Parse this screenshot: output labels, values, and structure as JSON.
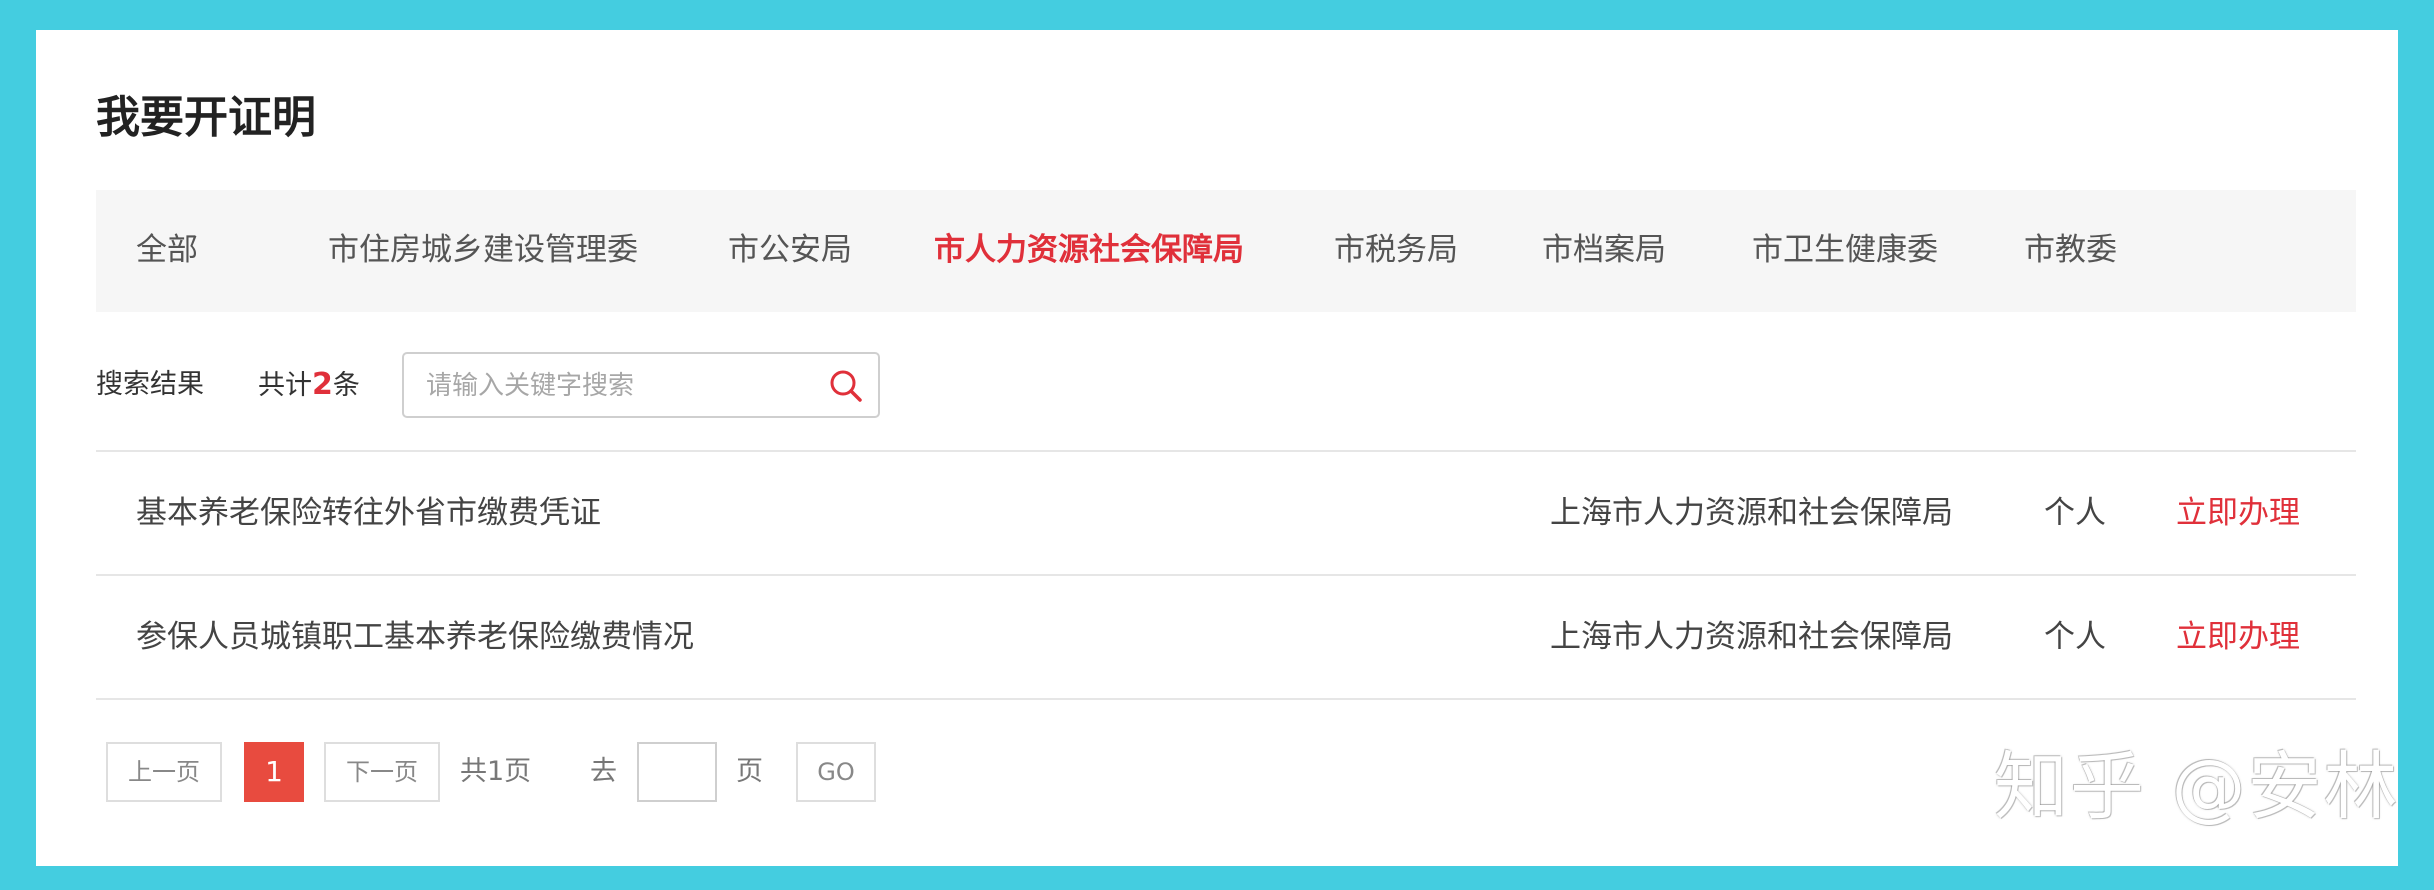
{
  "page": {
    "title": "我要开证明"
  },
  "tabs": [
    {
      "label": "全部"
    },
    {
      "label": "市住房城乡建设管理委"
    },
    {
      "label": "市公安局"
    },
    {
      "label": "市人力资源社会保障局",
      "active": true
    },
    {
      "label": "市税务局"
    },
    {
      "label": "市档案局"
    },
    {
      "label": "市卫生健康委"
    },
    {
      "label": "市教委"
    }
  ],
  "search": {
    "result_label": "搜索结果",
    "count_prefix": "共计",
    "count": "2",
    "count_suffix": "条",
    "placeholder": "请输入关键字搜索",
    "value": ""
  },
  "results": [
    {
      "name": "基本养老保险转往外省市缴费凭证",
      "dept": "上海市人力资源和社会保障局",
      "type": "个人",
      "action": "立即办理"
    },
    {
      "name": "参保人员城镇职工基本养老保险缴费情况",
      "dept": "上海市人力资源和社会保障局",
      "type": "个人",
      "action": "立即办理"
    }
  ],
  "pagination": {
    "prev": "上一页",
    "current": "1",
    "next": "下一页",
    "total": "共1页",
    "goto_label": "去",
    "page_unit": "页",
    "go": "GO"
  },
  "watermark": "知乎 @安林",
  "colors": {
    "accent": "#e0303a",
    "page_bg": "#44cde0",
    "current_page_bg": "#e84b3f"
  }
}
